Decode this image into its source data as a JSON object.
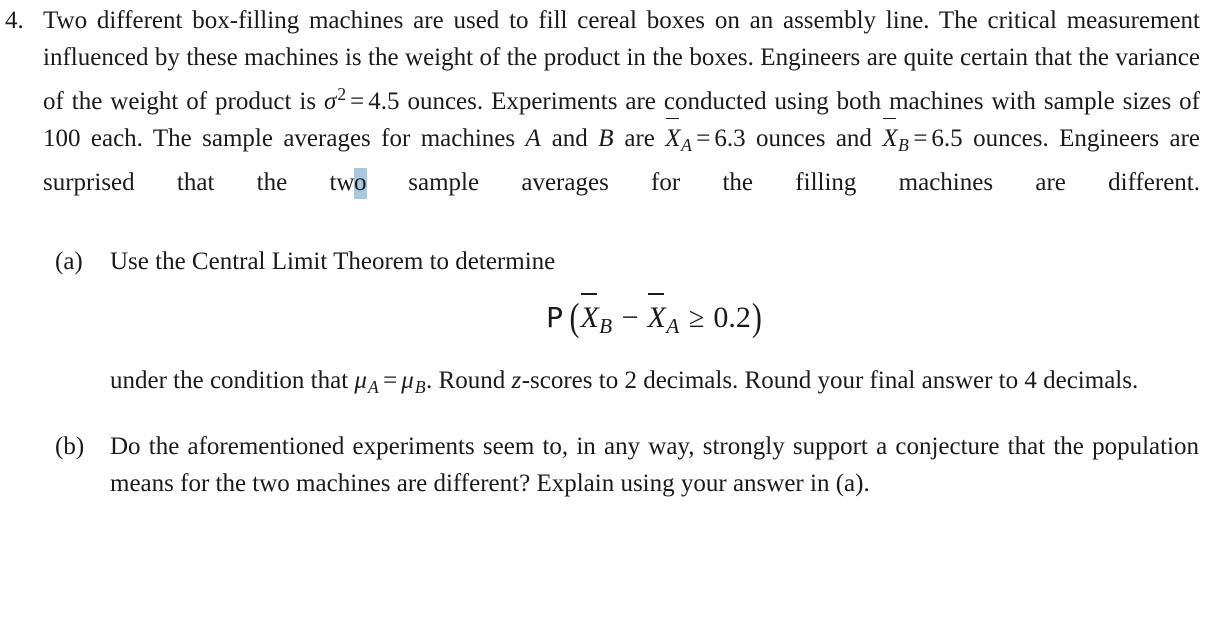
{
  "document": {
    "type": "statistics-problem",
    "background_color": "#ffffff",
    "text_color": "#1a1a1a",
    "selection_highlight_color": "#a8c8e0"
  },
  "problem": {
    "number": "4.",
    "stem": {
      "seg_1": "Two different box-filling machines are used to fill cereal boxes on an assembly line. The critical measurement influenced by these machines is the weight of the product in the boxes. Engineers are quite certain that the variance of the weight of product is ",
      "sigma": "σ",
      "sigma_exponent": "2",
      "equals_1": "=",
      "variance_value": "4.5",
      "seg_2": " ounces. Experiments are conducted using both machines with sample sizes of 100 each. The sample averages for machines ",
      "machine_a": "A",
      "seg_3": " and ",
      "machine_b": "B",
      "seg_4": " are ",
      "xbar_a_symbol": "X",
      "xbar_a_sub": "A",
      "equals_2": "=",
      "xbar_a_value": "6.3",
      "seg_5": " ounces and ",
      "xbar_b_symbol": "X",
      "xbar_b_sub": "B",
      "equals_3": "=",
      "xbar_b_value": "6.5",
      "seg_6": " ounces. Engineers are surprised that the tw",
      "highlighted_char": "o",
      "seg_7": " sample averages for the filling machines are different."
    }
  },
  "parts": [
    {
      "label": "(a)",
      "intro": "Use the Central Limit Theorem to determine",
      "equation": {
        "probability_operator": "P",
        "open_paren": "(",
        "xbar_b_symbol": "X",
        "xbar_b_sub": "B",
        "minus": "−",
        "xbar_a_symbol": "X",
        "xbar_a_sub": "A",
        "relation": "≥",
        "threshold": "0.2",
        "close_paren": ")"
      },
      "after_seg_1": "under the condition that ",
      "mu_a_symbol": "μ",
      "mu_a_sub": "A",
      "mu_equals": "=",
      "mu_b_symbol": "μ",
      "mu_b_sub": "B",
      "after_seg_2": ". Round ",
      "z_symbol": "z",
      "after_seg_3": "-scores to 2 decimals. Round your final answer to 4 decimals."
    },
    {
      "label": "(b)",
      "text": "Do the aforementioned experiments seem to, in any way, strongly support a conjecture that the population means for the two machines are different? Explain using your answer in (a)."
    }
  ]
}
